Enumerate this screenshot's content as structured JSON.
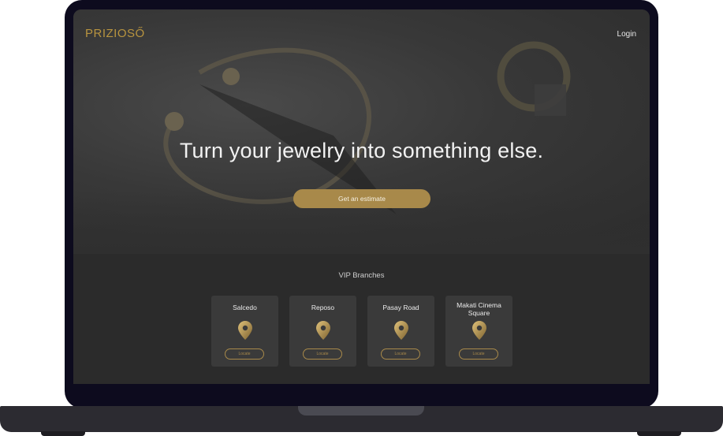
{
  "header": {
    "logo_text": "PRIZIOSŐ",
    "logo_sub": "",
    "login_label": "Login"
  },
  "hero": {
    "headline": "Turn your jewelry into something else.",
    "cta_label": "Get an estimate"
  },
  "branches": {
    "title": "VIP Branches",
    "items": [
      {
        "name": "Salcedo",
        "button": "Locate"
      },
      {
        "name": "Reposo",
        "button": "Locate"
      },
      {
        "name": "Pasay Road",
        "button": "Locate"
      },
      {
        "name": "Makati Cinema Square",
        "button": "Locate"
      }
    ]
  },
  "colors": {
    "accent": "#a8894a",
    "background": "#2b2b2b",
    "card": "#3a3a3a",
    "bezel": "#0d0b1e"
  }
}
